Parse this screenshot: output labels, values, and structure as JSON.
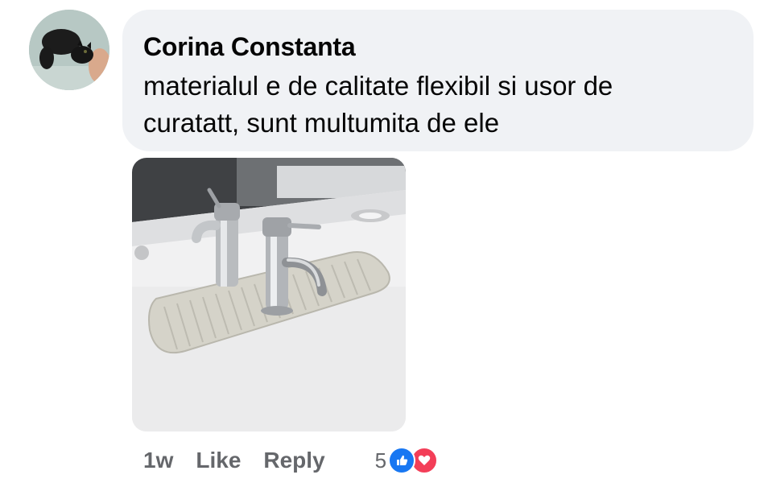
{
  "comment": {
    "author": "Corina Constanta",
    "text": "materialul e de calitate flexibil si usor de curatatt, sunt multumita de ele",
    "time": "1w",
    "like_label": "Like",
    "reply_label": "Reply",
    "reaction_count": "5",
    "reactions": [
      "like-icon",
      "love-icon"
    ]
  },
  "colors": {
    "bubble_bg": "#f0f2f5",
    "secondary_text": "#65676b",
    "like_blue": "#1877f2",
    "love_red": "#f33e58"
  }
}
